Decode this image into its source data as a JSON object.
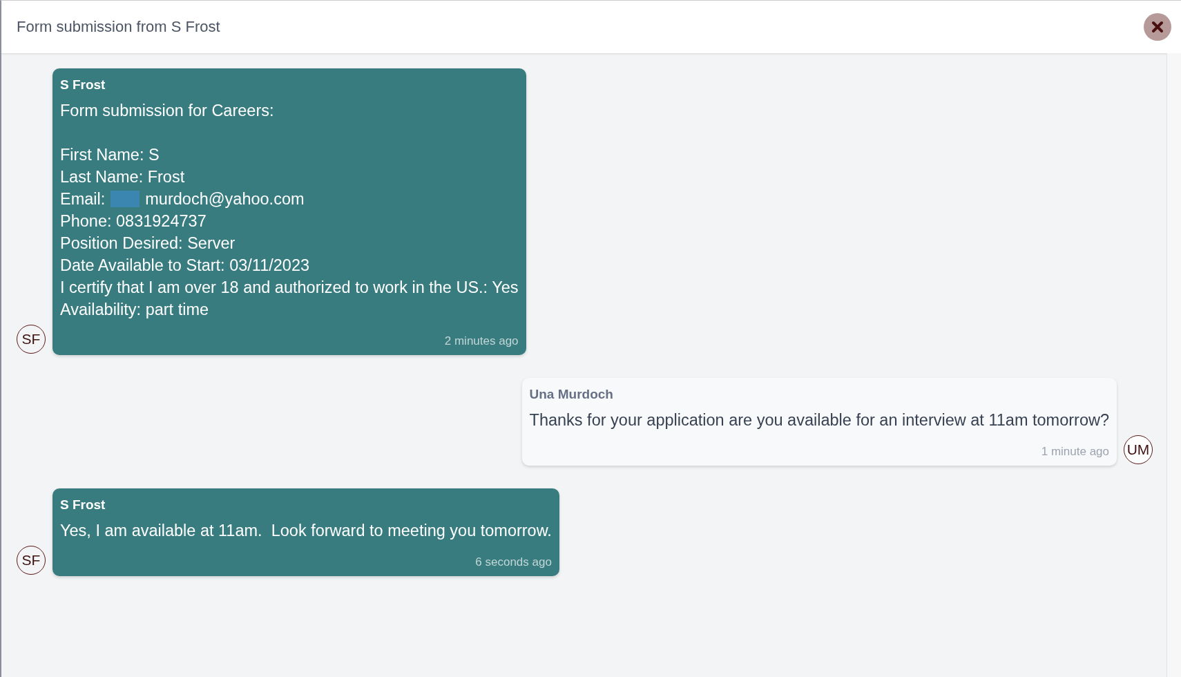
{
  "dialog": {
    "title": "Form submission from S Frost"
  },
  "messages": [
    {
      "kind": "incoming",
      "sender": "S Frost",
      "avatar": "SF",
      "time": "2 minutes ago",
      "lines": [
        {
          "kind": "text",
          "text": "Form submission for Careers:"
        },
        {
          "kind": "blank"
        },
        {
          "kind": "text",
          "text": "First Name: S"
        },
        {
          "kind": "text",
          "text": "Last Name: Frost"
        },
        {
          "kind": "redacted",
          "before": "Email:",
          "after": "murdoch@yahoo.com"
        },
        {
          "kind": "text",
          "text": "Phone: 0831924737"
        },
        {
          "kind": "text",
          "text": "Position Desired: Server"
        },
        {
          "kind": "text",
          "text": "Date Available to Start: 03/11/2023"
        },
        {
          "kind": "text",
          "text": "I certify that I am over 18 and authorized to work in the US.: Yes"
        },
        {
          "kind": "text",
          "text": "Availability: part time"
        }
      ]
    },
    {
      "kind": "outgoing",
      "sender": "Una Murdoch",
      "avatar": "UM",
      "time": "1 minute ago",
      "lines": [
        {
          "kind": "text",
          "text": "Thanks for your application are you available for an interview at 11am tomorrow?"
        }
      ]
    },
    {
      "kind": "incoming",
      "sender": "S Frost",
      "avatar": "SF",
      "time": "6 seconds ago",
      "lines": [
        {
          "kind": "text",
          "text": "Yes, I am available at 11am.  Look forward to meeting you tomorrow."
        }
      ]
    }
  ]
}
